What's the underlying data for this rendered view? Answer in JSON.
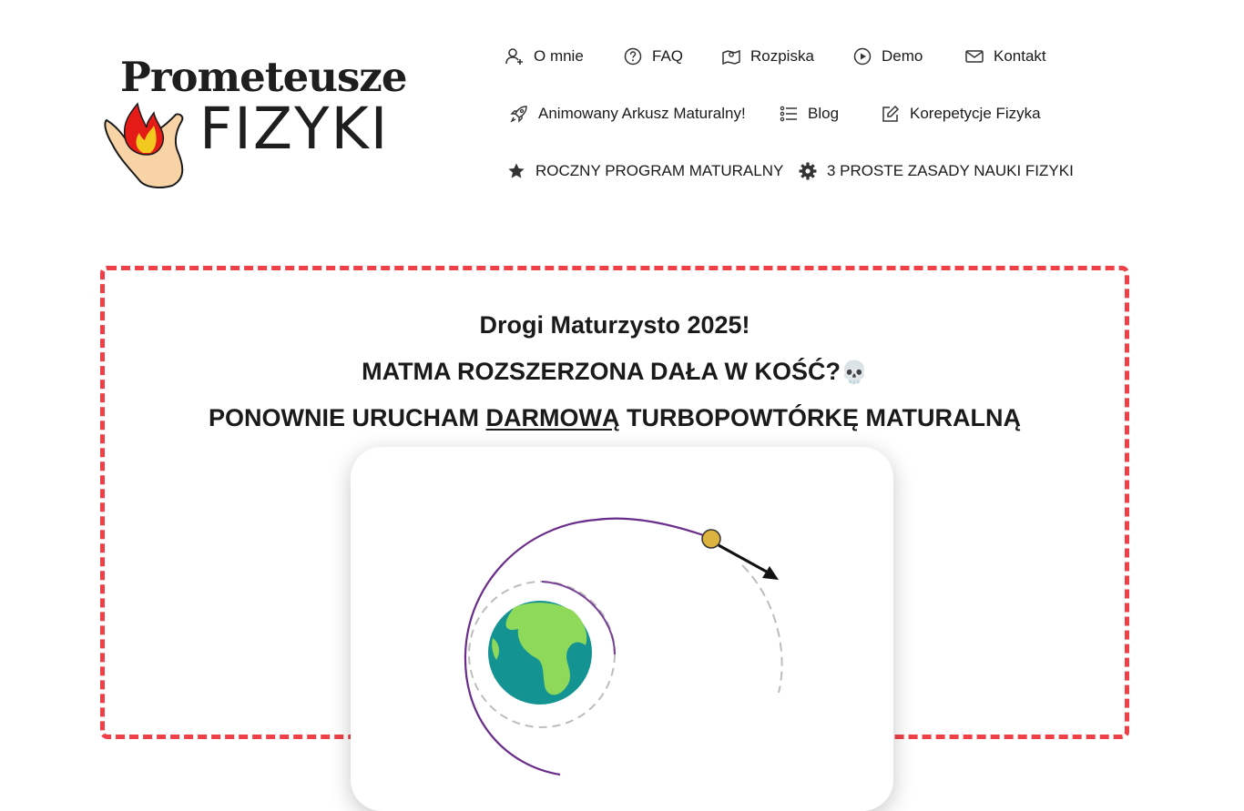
{
  "logo": {
    "line1": "Prometeusze",
    "line2": "FIZYKI"
  },
  "nav": {
    "items": [
      {
        "label": "O mnie",
        "icon": "user-plus-icon"
      },
      {
        "label": "FAQ",
        "icon": "question-circle-icon"
      },
      {
        "label": "Rozpiska",
        "icon": "map-pin-icon"
      },
      {
        "label": "Demo",
        "icon": "play-circle-icon"
      },
      {
        "label": "Kontakt",
        "icon": "envelope-icon"
      },
      {
        "label": "Animowany Arkusz Maturalny!",
        "icon": "rocket-icon"
      },
      {
        "label": "Blog",
        "icon": "list-icon"
      },
      {
        "label": "Korepetycje Fizyka",
        "icon": "edit-icon"
      },
      {
        "label": "ROCZNY PROGRAM MATURALNY",
        "icon": "star-icon"
      },
      {
        "label": "3 PROSTE ZASADY NAUKI FIZYKI",
        "icon": "gear-icon"
      }
    ]
  },
  "promo": {
    "line1": "Drogi Maturzysto 2025!",
    "line2": "MATMA ROZSZERZONA DAŁA W KOŚĆ?",
    "line2_emoji": "💀",
    "line3_pre": "PONOWNIE URUCHAM ",
    "line3_underlined": "DARMOWĄ",
    "line3_post": " TURBOPOWTÓRKĘ MATURALNĄ"
  },
  "colors": {
    "accent": "#ef4048",
    "orbit": "#6a2c8a",
    "satellite": "#ddb33f",
    "earth_land": "#8fd95a",
    "earth_ocean": "#149393"
  }
}
